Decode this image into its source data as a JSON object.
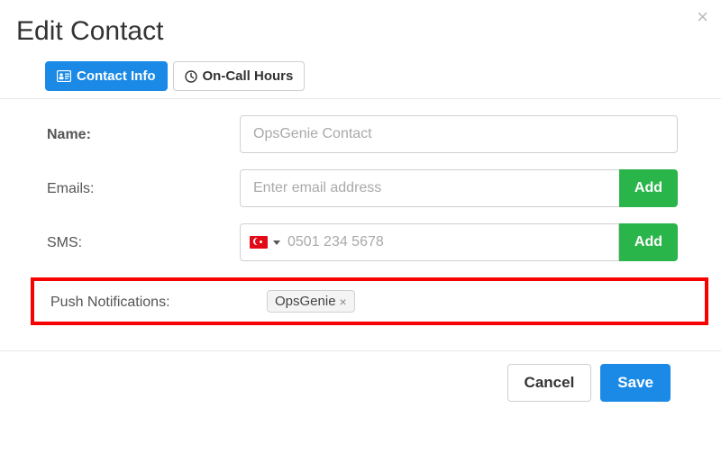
{
  "dialog": {
    "title": "Edit Contact",
    "close_glyph": "×"
  },
  "tabs": {
    "contact_info": "Contact Info",
    "oncall_hours": "On-Call Hours"
  },
  "labels": {
    "name": "Name:",
    "emails": "Emails:",
    "sms": "SMS:",
    "push": "Push Notifications:"
  },
  "fields": {
    "name_placeholder": "OpsGenie Contact",
    "email_placeholder": "Enter email address",
    "sms_placeholder": "0501 234 5678",
    "sms_country": "TR"
  },
  "buttons": {
    "add": "Add",
    "cancel": "Cancel",
    "save": "Save"
  },
  "push_tags": {
    "opsgenie": "OpsGenie",
    "remove_glyph": "×"
  }
}
